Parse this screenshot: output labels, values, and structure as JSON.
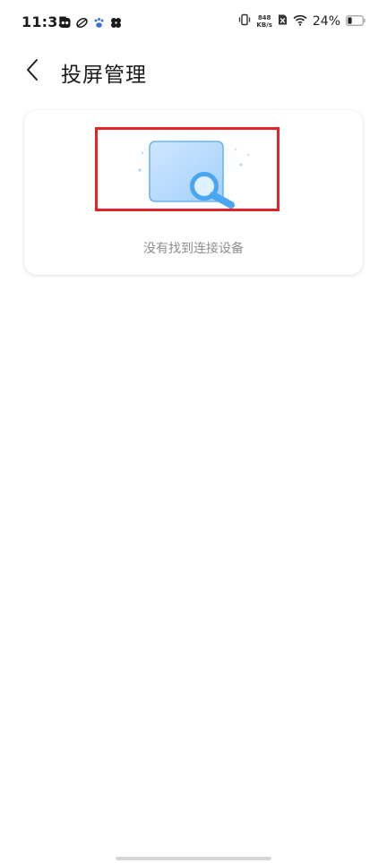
{
  "status_bar": {
    "time": "11:35",
    "net_speed_value": "848",
    "net_speed_unit": "KB/s",
    "battery_percent": "24%"
  },
  "header": {
    "title": "投屏管理"
  },
  "content": {
    "empty_message": "没有找到连接设备"
  },
  "colors": {
    "highlight_border": "#e3232a",
    "illustration_blue": "#4aa6f0"
  }
}
